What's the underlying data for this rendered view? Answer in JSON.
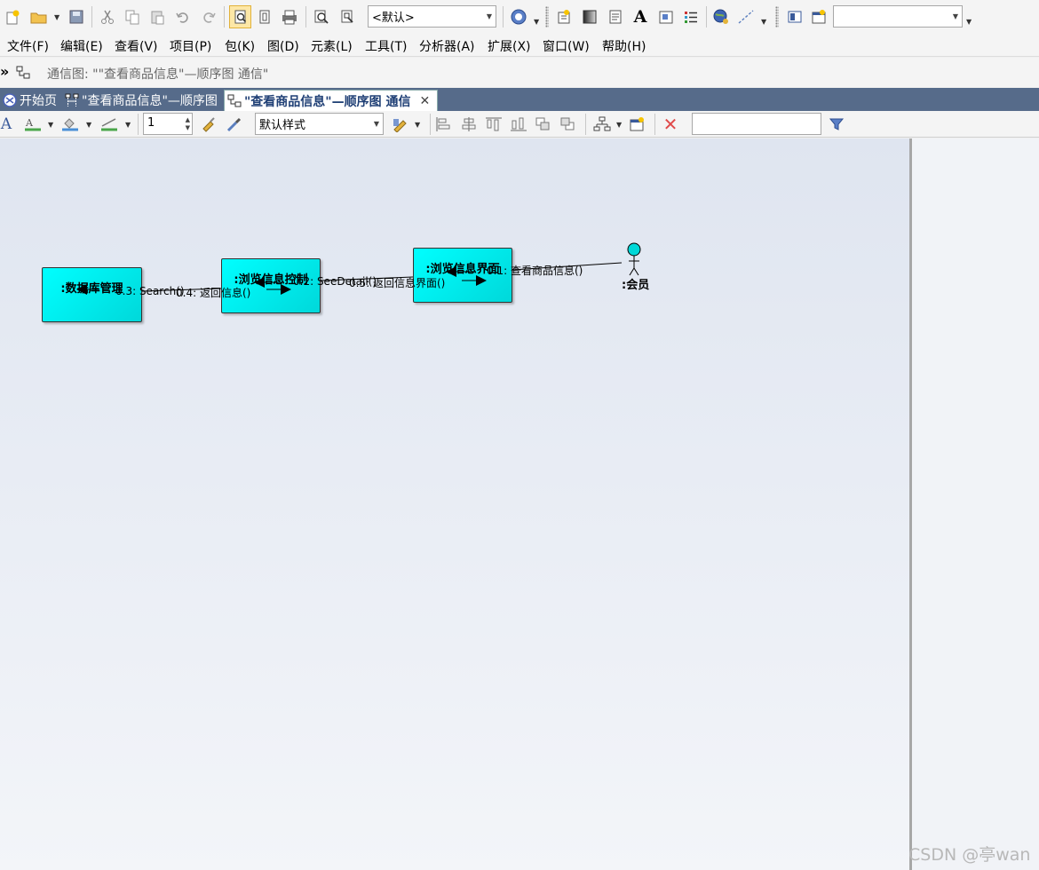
{
  "toolbar": {
    "view_combo_value": "<默认>",
    "search_combo_value": ""
  },
  "menu": [
    "文件(F)",
    "编辑(E)",
    "查看(V)",
    "项目(P)",
    "包(K)",
    "图(D)",
    "元素(L)",
    "工具(T)",
    "分析器(A)",
    "扩展(X)",
    "窗口(W)",
    "帮助(H)"
  ],
  "breadcrumb": {
    "chevron": "»",
    "text": "通信图: \"\"查看商品信息\"—顺序图 通信\""
  },
  "tabs": [
    {
      "label": "开始页"
    },
    {
      "label": "\"查看商品信息\"—顺序图"
    },
    {
      "label": "\"查看商品信息\"—顺序图 通信",
      "close": "✕"
    }
  ],
  "diagram_toolbar": {
    "line_width": "1",
    "style_value": "默认样式",
    "filter_value": ""
  },
  "diagram": {
    "nodes": [
      {
        "label": ":数据库管理"
      },
      {
        "label": ":浏览信息控制"
      },
      {
        "label": ":浏览信息界面"
      }
    ],
    "actor": {
      "label": ":会员"
    },
    "messages": [
      {
        "text": "0.3: Search()"
      },
      {
        "text": "0.4: 返回信息()"
      },
      {
        "text": "0.2: SeeDetail()"
      },
      {
        "text": "0.5: 返回信息界面()"
      },
      {
        "text": "0.1: 查看商品信息()"
      }
    ],
    "colors": {
      "node_fill": "#00e8e8",
      "actor_head": "#00d8d8"
    }
  },
  "watermark": "CSDN @亭wan"
}
